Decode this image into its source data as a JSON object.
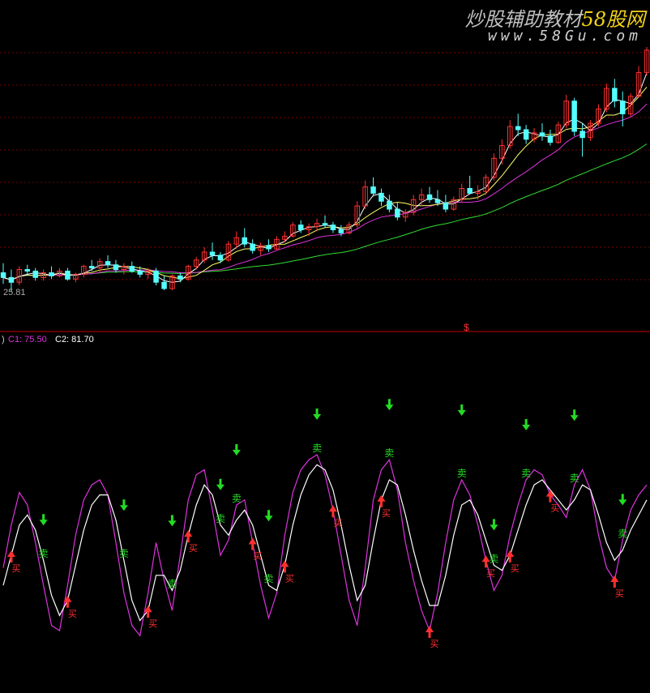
{
  "watermark": {
    "title_part1": "炒股辅助教材",
    "title_part2": "58股网",
    "url": "www.58Gu.com"
  },
  "colors": {
    "background": "#000000",
    "grid": "#7a0000",
    "separator": "#c80000",
    "candle_up": "#ff3030",
    "candle_down": "#55ffff",
    "ma_fast": "#ffffff",
    "ma_mid": "#ffff66",
    "ma_purple": "#dd33dd",
    "ma_green": "#33dd33",
    "c1": "#dd33dd",
    "c2": "#ffffff",
    "sell_signal": "#22dd22",
    "buy_signal": "#ff3030"
  },
  "upper_panel": {
    "low_price_label": "25.81",
    "marker_glyph": "$"
  },
  "lower_panel": {
    "prefix": ")",
    "c1_label": "C1: 75.50",
    "c2_label": "C2: 81.70"
  },
  "icons": {
    "sell_arrow": "down-arrow-icon",
    "buy_arrow": "up-arrow-icon"
  },
  "signal_labels": {
    "sell": "卖",
    "buy": "买"
  },
  "chart_data": [
    {
      "type": "candlestick",
      "title": "",
      "grid": true,
      "notes": "Daily candles with moving averages; price axis values not printed except lowest label",
      "price_low_label": 25.81,
      "candles": [
        [
          27.0,
          27.6,
          26.3,
          26.7
        ],
        [
          26.7,
          27.2,
          25.8,
          26.4
        ],
        [
          26.4,
          27.4,
          26.2,
          27.2
        ],
        [
          27.2,
          27.5,
          26.8,
          27.1
        ],
        [
          27.1,
          27.3,
          26.5,
          26.7
        ],
        [
          26.7,
          27.2,
          26.5,
          27.0
        ],
        [
          27.0,
          27.4,
          26.6,
          26.8
        ],
        [
          26.8,
          27.3,
          26.7,
          27.1
        ],
        [
          27.1,
          27.3,
          26.5,
          26.6
        ],
        [
          26.6,
          27.0,
          26.4,
          26.9
        ],
        [
          26.9,
          27.5,
          26.7,
          27.4
        ],
        [
          27.4,
          27.8,
          27.1,
          27.3
        ],
        [
          27.3,
          27.9,
          27.0,
          27.7
        ],
        [
          27.7,
          28.1,
          27.3,
          27.5
        ],
        [
          27.5,
          27.8,
          27.0,
          27.2
        ],
        [
          27.2,
          27.6,
          26.9,
          27.4
        ],
        [
          27.4,
          27.7,
          27.0,
          27.1
        ],
        [
          27.1,
          27.4,
          26.7,
          26.9
        ],
        [
          26.9,
          27.3,
          26.6,
          27.1
        ],
        [
          27.1,
          27.3,
          26.2,
          26.4
        ],
        [
          26.4,
          26.8,
          25.9,
          26.0
        ],
        [
          26.0,
          26.9,
          25.9,
          26.8
        ],
        [
          26.8,
          27.0,
          26.4,
          26.6
        ],
        [
          26.6,
          27.5,
          26.5,
          27.4
        ],
        [
          27.4,
          28.0,
          27.2,
          27.8
        ],
        [
          27.8,
          28.6,
          27.6,
          28.3
        ],
        [
          28.3,
          28.9,
          27.8,
          28.1
        ],
        [
          28.1,
          28.3,
          27.6,
          27.8
        ],
        [
          27.8,
          29.0,
          27.7,
          28.8
        ],
        [
          28.8,
          29.6,
          28.5,
          29.2
        ],
        [
          29.2,
          29.8,
          28.6,
          28.8
        ],
        [
          28.8,
          29.1,
          28.2,
          28.4
        ],
        [
          28.4,
          28.9,
          28.1,
          28.7
        ],
        [
          28.7,
          29.1,
          28.3,
          28.5
        ],
        [
          28.5,
          29.3,
          28.4,
          29.1
        ],
        [
          29.1,
          29.6,
          28.9,
          29.3
        ],
        [
          29.3,
          30.2,
          29.2,
          30.0
        ],
        [
          30.0,
          30.3,
          29.5,
          29.7
        ],
        [
          29.7,
          30.1,
          29.3,
          29.9
        ],
        [
          29.9,
          30.4,
          29.6,
          30.1
        ],
        [
          30.1,
          30.6,
          29.8,
          30.0
        ],
        [
          30.0,
          30.2,
          29.5,
          29.7
        ],
        [
          29.7,
          30.0,
          29.3,
          29.5
        ],
        [
          29.5,
          30.2,
          29.4,
          30.0
        ],
        [
          30.0,
          31.5,
          29.8,
          31.2
        ],
        [
          31.2,
          32.8,
          31.0,
          32.4
        ],
        [
          32.4,
          33.0,
          31.8,
          32.0
        ],
        [
          32.0,
          32.3,
          31.2,
          31.5
        ],
        [
          31.5,
          31.9,
          30.8,
          31.0
        ],
        [
          31.0,
          31.4,
          30.3,
          30.5
        ],
        [
          30.5,
          31.0,
          30.2,
          30.8
        ],
        [
          30.8,
          31.9,
          30.6,
          31.6
        ],
        [
          31.6,
          32.3,
          31.2,
          31.9
        ],
        [
          31.9,
          32.4,
          31.4,
          31.6
        ],
        [
          31.6,
          32.2,
          31.2,
          31.4
        ],
        [
          31.4,
          31.9,
          30.8,
          31.0
        ],
        [
          31.0,
          31.8,
          30.9,
          31.6
        ],
        [
          31.6,
          32.6,
          31.4,
          32.3
        ],
        [
          32.3,
          33.1,
          32.0,
          32.0
        ],
        [
          32.0,
          32.5,
          31.6,
          32.1
        ],
        [
          32.1,
          33.2,
          31.9,
          33.0
        ],
        [
          33.0,
          34.5,
          32.8,
          34.2
        ],
        [
          34.2,
          35.4,
          33.8,
          35.0
        ],
        [
          35.0,
          36.6,
          34.8,
          36.2
        ],
        [
          36.2,
          37.0,
          35.6,
          36.0
        ],
        [
          36.0,
          36.3,
          35.1,
          35.4
        ],
        [
          35.4,
          36.1,
          35.2,
          35.8
        ],
        [
          35.8,
          36.4,
          35.3,
          35.6
        ],
        [
          35.6,
          36.0,
          35.0,
          35.2
        ],
        [
          35.2,
          36.5,
          35.1,
          36.3
        ],
        [
          36.3,
          38.2,
          36.1,
          37.8
        ],
        [
          37.8,
          38.0,
          35.6,
          35.9
        ],
        [
          35.9,
          36.4,
          34.3,
          35.5
        ],
        [
          35.5,
          36.6,
          35.3,
          36.4
        ],
        [
          36.4,
          37.6,
          36.2,
          37.3
        ],
        [
          37.3,
          38.9,
          37.1,
          38.6
        ],
        [
          38.6,
          39.2,
          37.4,
          37.8
        ],
        [
          37.8,
          38.4,
          36.2,
          37.0
        ],
        [
          37.0,
          38.3,
          36.8,
          38.1
        ],
        [
          38.1,
          40.0,
          38.0,
          39.6
        ],
        [
          39.6,
          41.2,
          39.4,
          41.0
        ]
      ]
    },
    {
      "type": "line",
      "title": "",
      "series": [
        {
          "name": "C1",
          "values": [
            45,
            62,
            75,
            70,
            55,
            38,
            22,
            20,
            38,
            58,
            72,
            78,
            80,
            74,
            55,
            35,
            22,
            18,
            35,
            55,
            40,
            28,
            50,
            72,
            82,
            84,
            68,
            50,
            56,
            70,
            72,
            55,
            38,
            25,
            35,
            58,
            75,
            84,
            88,
            90,
            82,
            68,
            50,
            32,
            22,
            45,
            72,
            84,
            88,
            76,
            55,
            40,
            28,
            20,
            35,
            55,
            72,
            80,
            74,
            62,
            48,
            36,
            42,
            58,
            70,
            80,
            84,
            82,
            74,
            70,
            65,
            78,
            84,
            76,
            58,
            45,
            40,
            56,
            68,
            74,
            78
          ]
        },
        {
          "name": "C2",
          "values": [
            38,
            50,
            62,
            66,
            60,
            48,
            34,
            26,
            32,
            46,
            60,
            70,
            74,
            74,
            64,
            48,
            32,
            24,
            28,
            42,
            42,
            36,
            44,
            58,
            70,
            78,
            74,
            62,
            58,
            64,
            68,
            62,
            50,
            38,
            36,
            46,
            62,
            74,
            82,
            86,
            84,
            76,
            62,
            46,
            32,
            38,
            56,
            72,
            80,
            78,
            66,
            52,
            40,
            30,
            30,
            42,
            58,
            70,
            72,
            66,
            56,
            46,
            44,
            50,
            60,
            70,
            78,
            80,
            76,
            72,
            68,
            72,
            78,
            76,
            66,
            55,
            48,
            52,
            60,
            66,
            72
          ]
        }
      ],
      "sell_signal_indices": [
        5,
        15,
        21,
        27,
        29,
        33,
        39,
        48,
        57,
        61,
        65,
        71,
        77
      ],
      "buy_signal_indices": [
        1,
        8,
        18,
        23,
        31,
        35,
        41,
        47,
        53,
        60,
        63,
        68,
        76
      ],
      "separator_marker_index": 65
    }
  ]
}
